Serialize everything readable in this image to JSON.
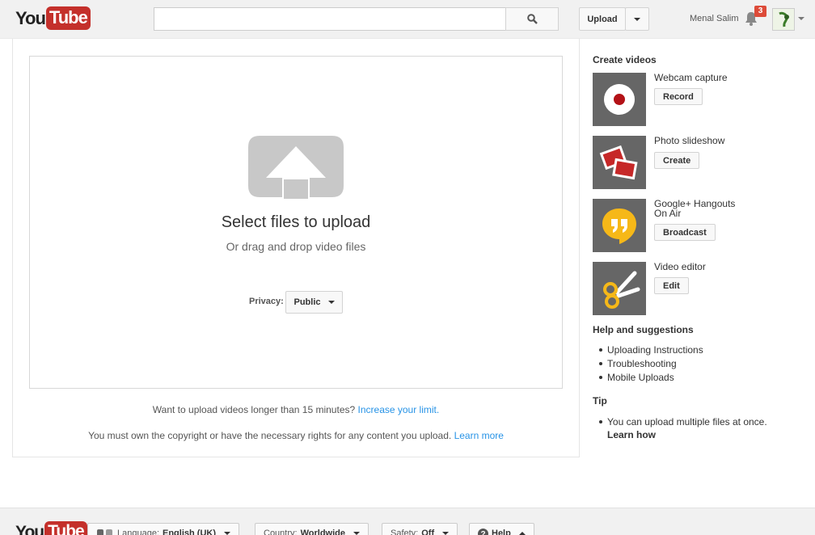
{
  "header": {
    "logo": {
      "you": "You",
      "tube": "Tube"
    },
    "search": {
      "placeholder": "",
      "icon": "search-icon"
    },
    "upload_label": "Upload",
    "username": "Menal Salim",
    "notification_count": "3"
  },
  "upload": {
    "title": "Select files to upload",
    "subtitle": "Or drag and drop video files",
    "privacy_label": "Privacy:",
    "privacy_value": "Public",
    "limit_text": "Want to upload videos longer than 15 minutes?",
    "limit_link": "Increase your limit.",
    "copyright_text": "You must own the copyright or have the necessary rights for any content you upload.",
    "copyright_link": "Learn more"
  },
  "sidebar": {
    "create_heading": "Create videos",
    "create_items": [
      {
        "title": "Webcam capture",
        "button": "Record",
        "icon": "webcam-record-icon"
      },
      {
        "title": "Photo slideshow",
        "button": "Create",
        "icon": "photo-slideshow-icon"
      },
      {
        "title_line1": "Google+ Hangouts",
        "title_line2": "On Air",
        "button": "Broadcast",
        "icon": "hangouts-icon"
      },
      {
        "title": "Video editor",
        "button": "Edit",
        "icon": "scissors-icon"
      }
    ],
    "help_heading": "Help and suggestions",
    "help_links": [
      "Uploading Instructions",
      "Troubleshooting",
      "Mobile Uploads"
    ],
    "tip_heading": "Tip",
    "tip_text": "You can upload multiple files at once.",
    "tip_link": "Learn how"
  },
  "footer": {
    "logo": {
      "you": "You",
      "tube": "Tube"
    },
    "language_label": "Language:",
    "language_value": "English (UK)",
    "country_label": "Country:",
    "country_value": "Worldwide",
    "safety_label": "Safety:",
    "safety_value": "Off",
    "help_label": "Help"
  },
  "colors": {
    "brand_red": "#c4302b",
    "link": "#2793e6",
    "badge": "#dd4b39"
  }
}
